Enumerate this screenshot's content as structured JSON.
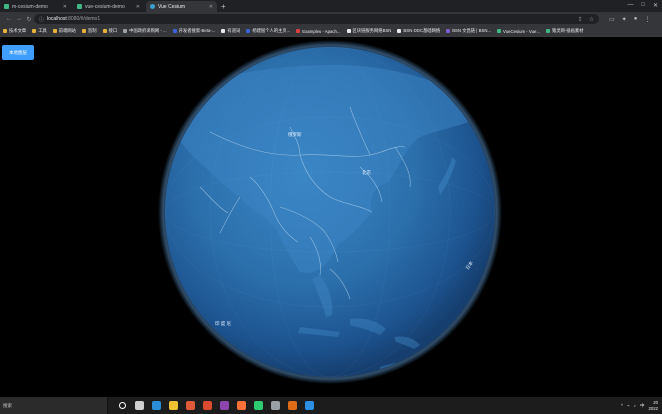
{
  "browser": {
    "tabs": [
      {
        "label": "m-cesium-demo",
        "icon_color": "#41b883",
        "active": false
      },
      {
        "label": "vue-cesium-demo",
        "icon_color": "#41b883",
        "active": false
      },
      {
        "label": "Vue Cesium",
        "icon_color": "#3aa0d0",
        "active": true
      }
    ],
    "new_tab": "+",
    "window_controls": [
      "—",
      "□",
      "✕"
    ],
    "url_host": "localhost",
    "url_path": ":8080/#/demo1",
    "bookmarks": [
      {
        "label": "技术文章",
        "icon_color": "#e7b23a"
      },
      {
        "label": "工具",
        "icon_color": "#e7b23a"
      },
      {
        "label": "前端网站",
        "icon_color": "#e7b23a"
      },
      {
        "label": "监制",
        "icon_color": "#e7b23a"
      },
      {
        "label": "接口",
        "icon_color": "#e7b23a"
      },
      {
        "label": "中国政府采购网 - ...",
        "icon_color": "#9aa0a6"
      },
      {
        "label": "开发者搜索-Beta-...",
        "icon_color": "#3b63d9"
      },
      {
        "label": "有道词",
        "icon_color": "#e8eaed"
      },
      {
        "label": "杨建国个人的主页...",
        "icon_color": "#3b63d9"
      },
      {
        "label": "Examples - Apach...",
        "icon_color": "#d9403b"
      },
      {
        "label": "区块链服务网络BSN",
        "icon_color": "#e8eaed"
      },
      {
        "label": "BSN-DDC基础网络",
        "icon_color": "#e8eaed"
      },
      {
        "label": "BSN 文昌链 | BSN...",
        "icon_color": "#7a5cd6"
      },
      {
        "label": "VueCesium - Vue...",
        "icon_color": "#41b883"
      },
      {
        "label": "猿灵网-插画素材",
        "icon_color": "#41b883"
      }
    ]
  },
  "page": {
    "demo_button": "本地图层",
    "map_labels": {
      "russia": "俄罗斯",
      "beijing": "北京",
      "japan": "日本",
      "indonesia": "印 度 尼"
    }
  },
  "taskbar": {
    "search_placeholder": "搜索",
    "apps": [
      {
        "name": "windows-start-icon",
        "color": "#ffffff"
      },
      {
        "name": "task-view-icon",
        "color": "#cfcfcf"
      },
      {
        "name": "edge-icon",
        "color": "#2a8fd8"
      },
      {
        "name": "file-explorer-icon",
        "color": "#f1c232"
      },
      {
        "name": "chrome-icon",
        "color": "#e05a3a"
      },
      {
        "name": "office-icon",
        "color": "#d94a2e"
      },
      {
        "name": "visual-studio-icon",
        "color": "#8e44ad"
      },
      {
        "name": "firefox-icon",
        "color": "#ff7139"
      },
      {
        "name": "wechat-icon",
        "color": "#2ecc71"
      },
      {
        "name": "gitkraken-icon",
        "color": "#9aa0a6"
      },
      {
        "name": "app-icon-orange",
        "color": "#e06c1a"
      },
      {
        "name": "vscode-icon",
        "color": "#2b8fe6"
      }
    ],
    "tray_chinese": "中",
    "clock_time": "20",
    "clock_date": "2022"
  }
}
